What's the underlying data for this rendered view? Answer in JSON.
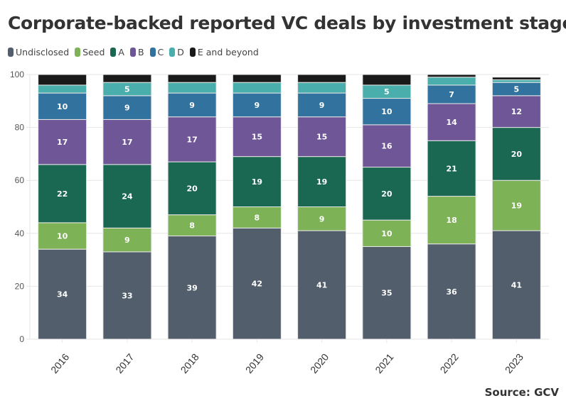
{
  "chart_data": {
    "type": "bar",
    "stacked": true,
    "title": "Corporate-backed reported VC deals by investment stage (%)",
    "xlabel": "",
    "ylabel": "",
    "ylim": [
      0,
      100
    ],
    "yticks": [
      0,
      20,
      40,
      60,
      80,
      100
    ],
    "grid": true,
    "legend_position": "top-left",
    "categories": [
      "2016",
      "2017",
      "2018",
      "2019",
      "2020",
      "2021",
      "2022",
      "2023"
    ],
    "series": [
      {
        "name": "Undisclosed",
        "color": "#525e6b",
        "values": [
          34,
          33,
          39,
          42,
          41,
          35,
          36,
          41
        ]
      },
      {
        "name": "Seed",
        "color": "#7db356",
        "values": [
          10,
          9,
          8,
          8,
          9,
          10,
          18,
          19
        ]
      },
      {
        "name": "A",
        "color": "#1b6852",
        "values": [
          22,
          24,
          20,
          19,
          19,
          20,
          21,
          20
        ]
      },
      {
        "name": "B",
        "color": "#6e5697",
        "values": [
          17,
          17,
          17,
          15,
          15,
          16,
          14,
          12
        ]
      },
      {
        "name": "C",
        "color": "#31729e",
        "values": [
          10,
          9,
          9,
          9,
          9,
          10,
          7,
          5
        ]
      },
      {
        "name": "D",
        "color": "#4aaeac",
        "values": [
          3,
          5,
          4,
          4,
          4,
          5,
          3,
          1
        ]
      },
      {
        "name": "E and beyond",
        "color": "#1a1a1a",
        "values": [
          4,
          3,
          3,
          3,
          3,
          4,
          1,
          1
        ]
      }
    ],
    "label_threshold": 5
  },
  "footer": {
    "source": "Source: GCV"
  }
}
